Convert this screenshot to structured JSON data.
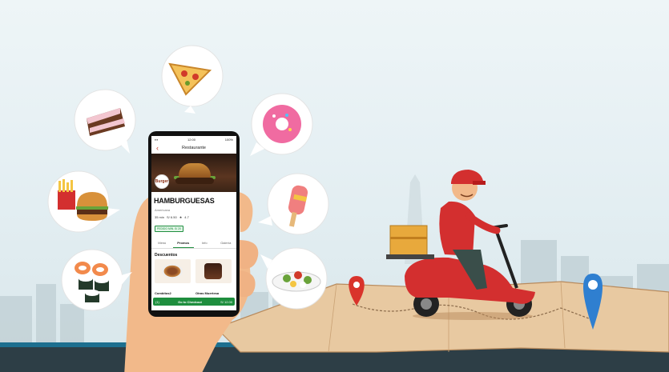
{
  "app": {
    "status": {
      "time": "12:00",
      "battery": "100%"
    },
    "header_title": "Restaurante",
    "restaurant": {
      "name": "HAMBURGUESAS",
      "cuisine": "Americana",
      "time": "35 min",
      "price": "S/ 6.50",
      "rating": "4.7",
      "badge": "PEDIDO MIN. S/ 20",
      "logo_text": "Burger"
    },
    "tabs": [
      {
        "label": "Menú",
        "active": false
      },
      {
        "label": "Promos",
        "active": true
      },
      {
        "label": "Info",
        "active": false
      },
      {
        "label": "Galería",
        "active": false
      }
    ],
    "section_title": "Descuentos",
    "cards": [
      {
        "name": "Combitos2"
      },
      {
        "name": "Otras Muertesa"
      }
    ],
    "checkout": {
      "count": "(1)",
      "label": "Go to Checkout",
      "total": "S/ 12.00"
    }
  },
  "colors": {
    "accent": "#1e8e3e",
    "scooter": "#d32f2f",
    "pin_red": "#d9332b",
    "pin_blue": "#2f7fd0"
  },
  "icons": [
    "pizza-slice-icon",
    "donut-icon",
    "cake-slice-icon",
    "fries-burger-icon",
    "popsicle-icon",
    "sushi-icon",
    "salad-bowl-icon",
    "location-pin-icon",
    "location-pin-icon"
  ]
}
